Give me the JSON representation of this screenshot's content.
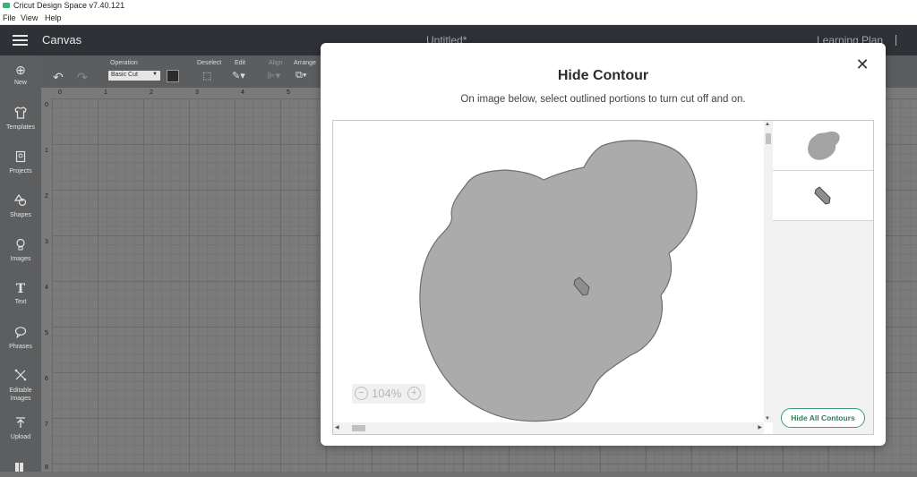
{
  "window": {
    "title": "Cricut Design Space  v7.40.121"
  },
  "menu": [
    "File",
    "View",
    "Help"
  ],
  "header": {
    "canvas_label": "Canvas",
    "doc_title": "Untitled*",
    "learning_plan": "Learning Plan"
  },
  "sidebar": {
    "items": [
      {
        "label": "New",
        "icon": "plus-circle-icon"
      },
      {
        "label": "Templates",
        "icon": "shirt-icon"
      },
      {
        "label": "Projects",
        "icon": "projects-icon"
      },
      {
        "label": "Shapes",
        "icon": "shapes-icon"
      },
      {
        "label": "Images",
        "icon": "lightbulb-icon"
      },
      {
        "label": "Text",
        "icon": "text-icon"
      },
      {
        "label": "Phrases",
        "icon": "speech-bubble-icon"
      },
      {
        "label": "Editable Images",
        "icon": "editable-images-icon"
      },
      {
        "label": "Upload",
        "icon": "upload-icon"
      }
    ]
  },
  "toolbar": {
    "operation_label": "Operation",
    "operation_value": "Basic Cut",
    "deselect_label": "Deselect",
    "edit_label": "Edit",
    "align_label": "Align",
    "arrange_label": "Arrange",
    "operation_color": "#2b2b2b"
  },
  "ruler": {
    "top_ticks": [
      "0",
      "1",
      "2",
      "3",
      "4",
      "5"
    ],
    "left_ticks": [
      "0",
      "1",
      "2",
      "3",
      "4",
      "5",
      "6",
      "7",
      "8"
    ]
  },
  "modal": {
    "title": "Hide Contour",
    "subtitle": "On image below, select outlined portions to turn cut off and on.",
    "zoom_value": "104%",
    "hide_all_label": "Hide All Contours",
    "layers": [
      {
        "shape": "cloud-blob"
      },
      {
        "shape": "small-tag"
      }
    ]
  },
  "colors": {
    "shape_fill": "#ababab",
    "shape_stroke": "#6e6e6e",
    "accent_green": "#3d9b6f",
    "header_bg": "#2e3236"
  }
}
